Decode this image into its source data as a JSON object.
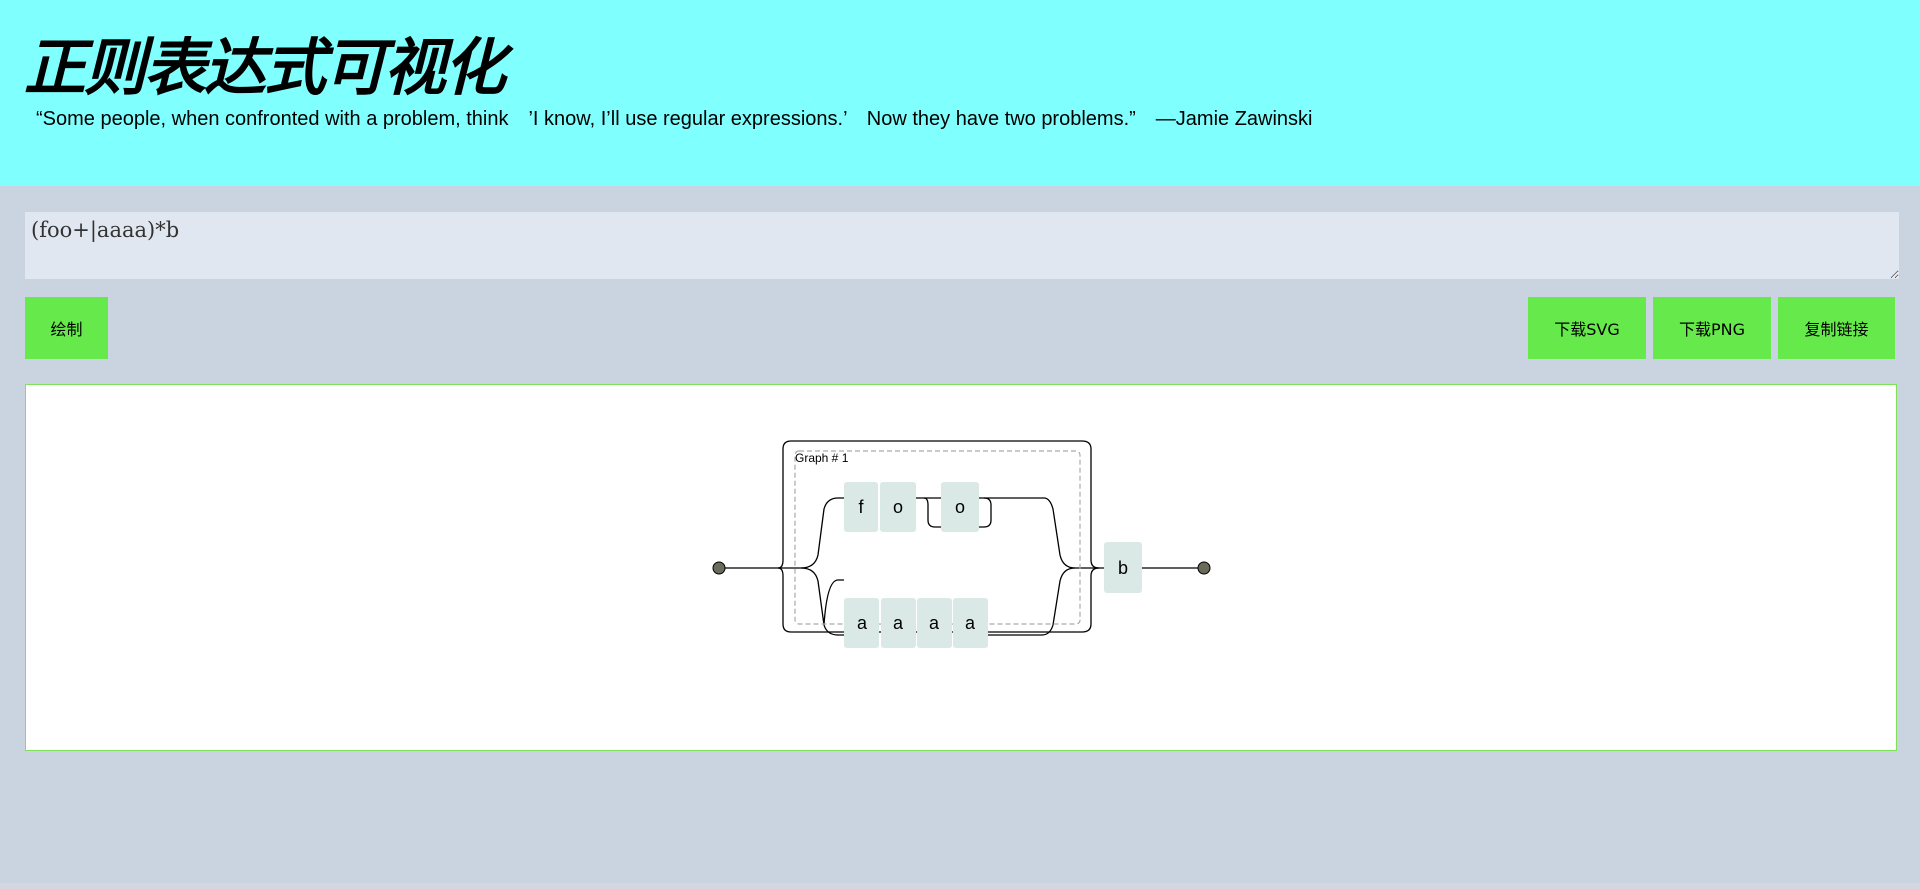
{
  "header": {
    "title": "正则表达式可视化",
    "quote": "“Some people, when confronted with a problem, think　’I know, I’ll use regular expressions.’　Now they have two problems.”　—Jamie Zawinski"
  },
  "regex": {
    "value": "(foo+|aaaa)*b"
  },
  "toolbar": {
    "draw_label": "绘制",
    "download_svg_label": "下载SVG",
    "download_png_label": "下载PNG",
    "copy_link_label": "复制链接"
  },
  "diagram": {
    "group_label": "Graph # 1",
    "literals": {
      "f": "f",
      "o1": "o",
      "o2": "o",
      "a1": "a",
      "a2": "a",
      "a3": "a",
      "a4": "a",
      "b": "b"
    }
  },
  "colors": {
    "header_bg": "#7ffffe",
    "page_bg": "#cad4e0",
    "button_bg": "#66e94b",
    "literal_bg": "#dae9e5"
  }
}
